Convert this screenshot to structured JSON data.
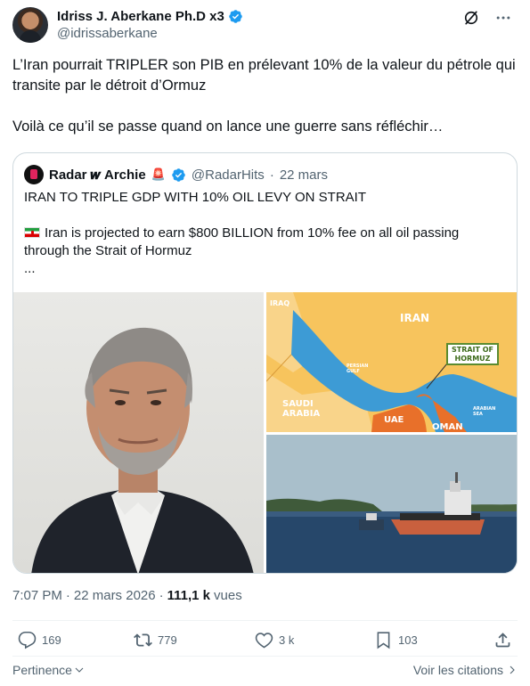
{
  "author": {
    "name": "Idriss J. Aberkane Ph.D x3",
    "handle": "@idrissaberkane"
  },
  "tweet": {
    "paragraphs": [
      "L’Iran pourrait TRIPLER son PIB en prélevant 10% de la valeur du pétrole qui transite par le détroit d’Ormuz",
      "Voilà ce qu’il se passe quand on lance une guerre sans réfléchir…"
    ]
  },
  "quote": {
    "name": "Radar 𝒘 Archie",
    "siren": "🚨",
    "handle": "@RadarHits",
    "separator": "·",
    "date": "22 mars",
    "headline": "IRAN TO TRIPLE GDP WITH 10% OIL LEVY ON STRAIT",
    "body": "Iran is projected to earn $800 BILLION from 10% fee on all oil passing through the Strait of Hormuz",
    "ellipsis": "...",
    "map": {
      "labels": {
        "iraq": "IRAQ",
        "iran": "IRAN",
        "saudi": "SAUDI\nARABIA",
        "uae": "UAE",
        "oman": "OMAN",
        "persian_gulf": "PERSIAN\nGULF",
        "arabian_sea": "ARABIAN\nSEA",
        "strait": "STRAIT OF\nHORMUZ"
      }
    }
  },
  "meta": {
    "time": "7:07 PM",
    "separator1": "·",
    "date": "22 mars 2026",
    "separator2": "·",
    "views_count": "111,1 k",
    "views_label": "vues"
  },
  "actions": {
    "replies": "169",
    "reposts": "779",
    "likes": "3 k",
    "bookmarks": "103"
  },
  "footer": {
    "relevance": "Pertinence",
    "quotes": "Voir les citations"
  },
  "colors": {
    "accent": "#1d9bf0",
    "text": "#0f1419",
    "muted": "#536471",
    "border": "#cfd9de"
  }
}
